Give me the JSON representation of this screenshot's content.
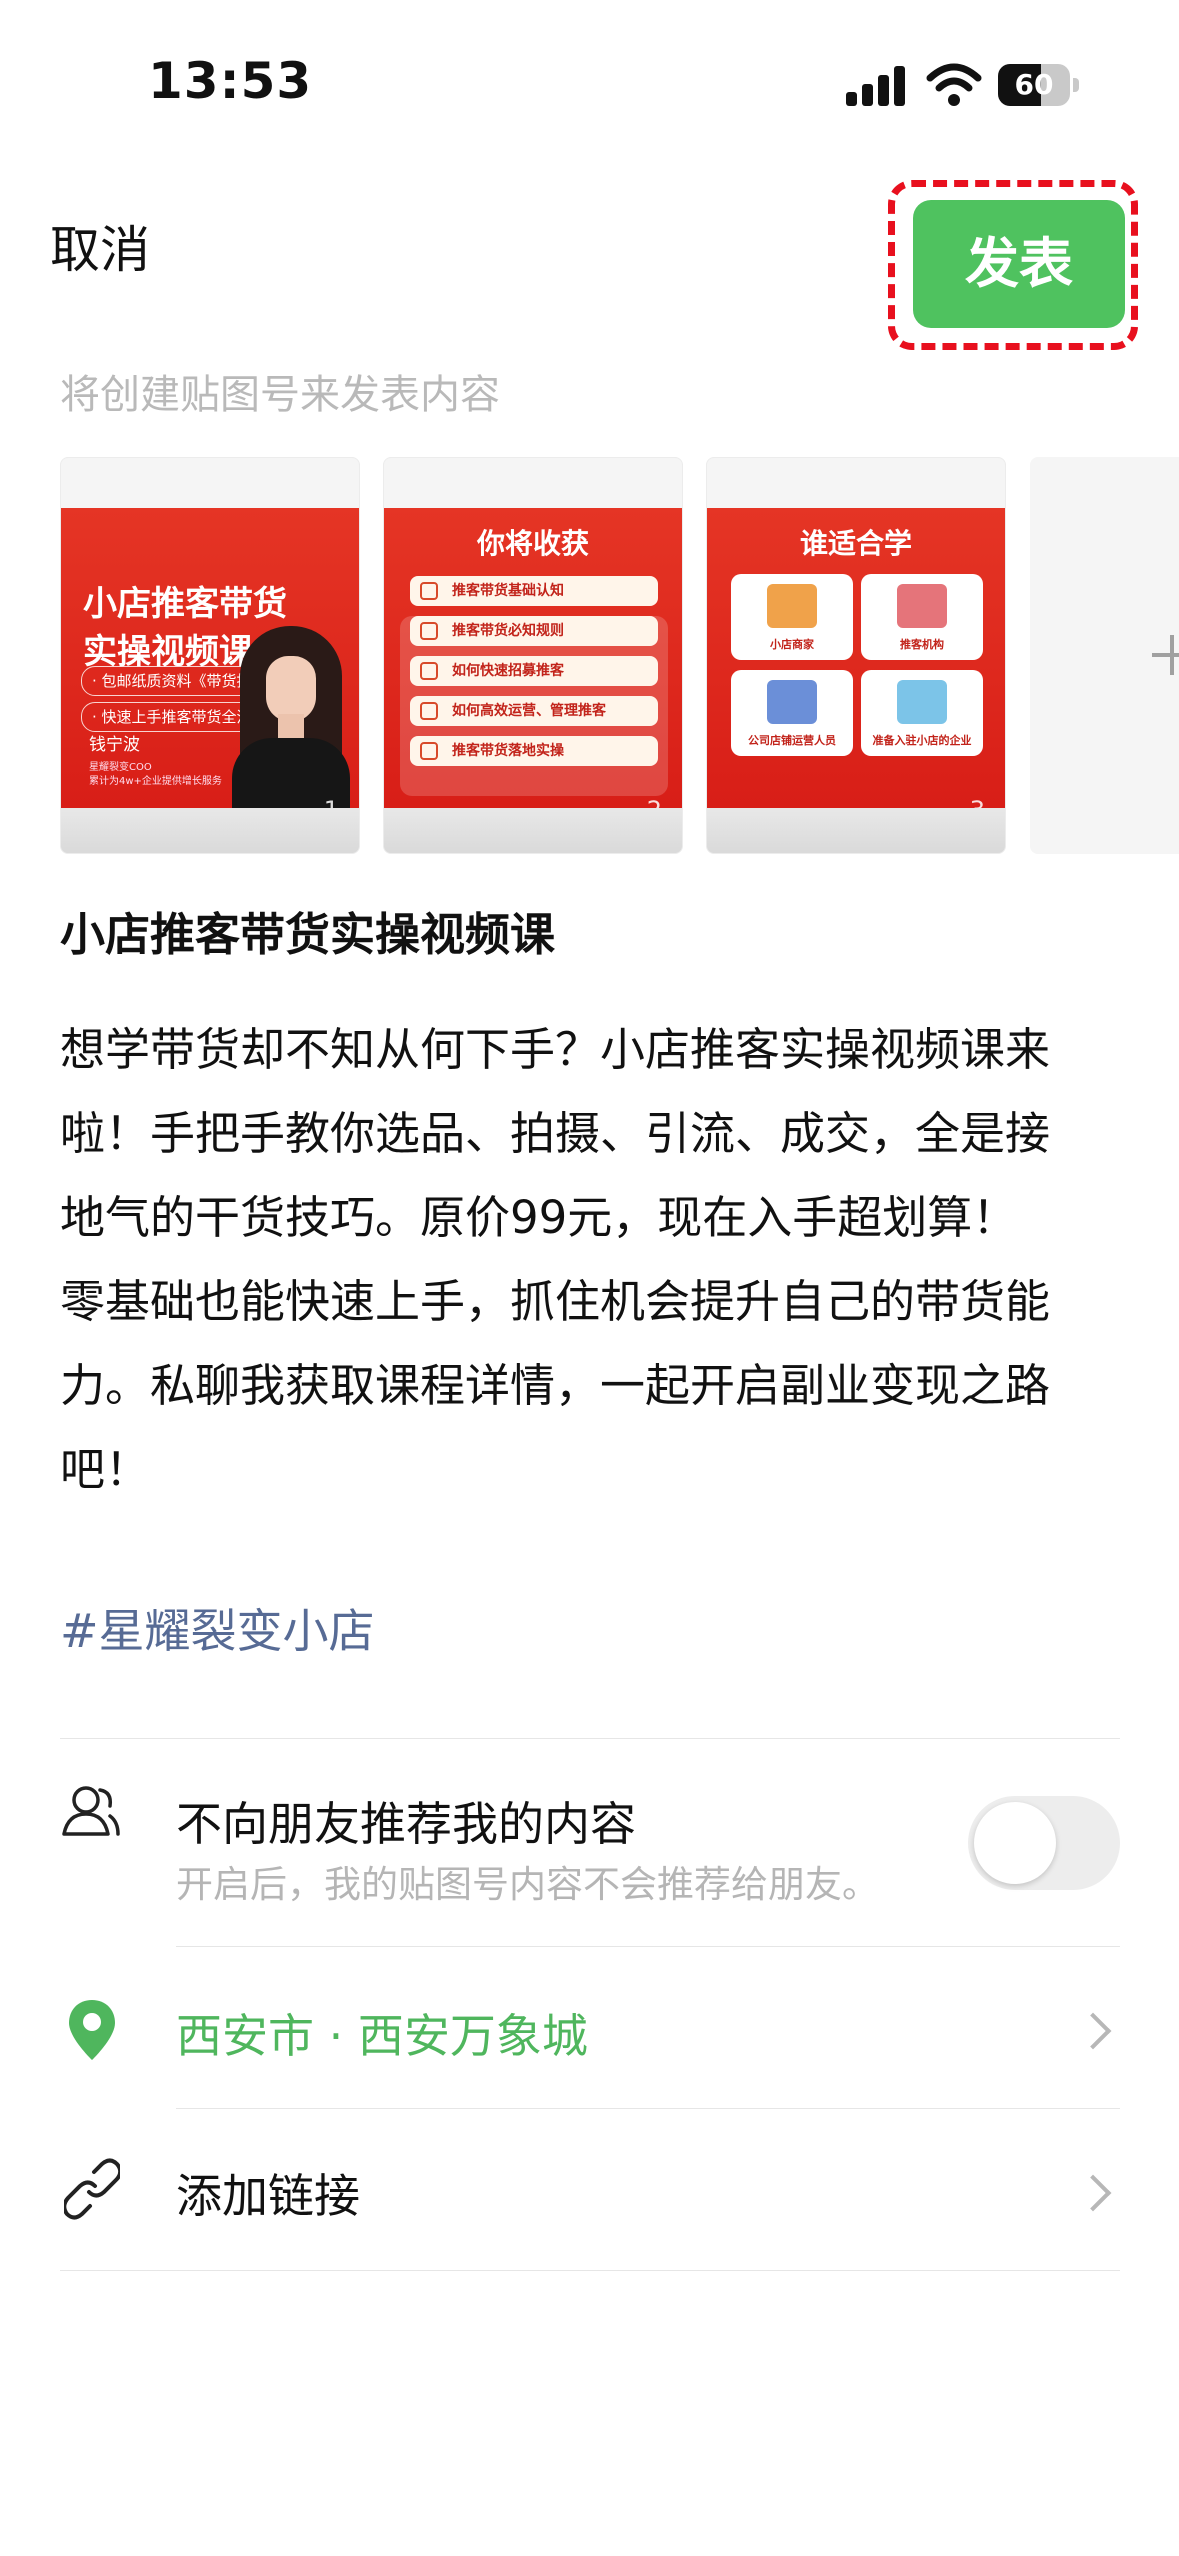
{
  "status_bar": {
    "time": "13:53",
    "battery": "60",
    "battery_level": 0.6
  },
  "header": {
    "cancel_label": "取消",
    "publish_label": "发表"
  },
  "hint": "将创建贴图号来发表内容",
  "thumbnails": [
    {
      "number": "1",
      "title_line1": "小店推客带货",
      "title_line2": "实操视频课",
      "tag1": "· 包邮纸质资料《带货指南》",
      "tag2": "· 快速上手推客带货全流程",
      "name": "钱宁波",
      "small1": "星耀裂变COO",
      "small2": "累计为4w+企业提供增长服务"
    },
    {
      "number": "2",
      "heading": "你将收获",
      "items": [
        "推客带货基础认知",
        "推客带货必知规则",
        "如何快速招募推客",
        "如何高效运营、管理推客",
        "推客带货落地实操"
      ]
    },
    {
      "number": "3",
      "heading": "谁适合学",
      "items": [
        "小店商家",
        "推客机构",
        "公司店铺运营人员",
        "准备入驻小店的企业"
      ]
    }
  ],
  "post": {
    "title": "小店推客带货实操视频课",
    "body_lines": [
      "想学带货却不知从何下手？小店推客实操视频课来",
      "啦！手把手教你选品、拍摄、引流、成交，全是接",
      "地气的干货技巧。原价99元，现在入手超划算！",
      "零基础也能快速上手，抓住机会提升自己的带货能",
      "力。私聊我获取课程详情，一起开启副业变现之路",
      "吧！"
    ],
    "hashtag": "#星耀裂变小店"
  },
  "settings": {
    "friends": {
      "title": "不向朋友推荐我的内容",
      "subtitle": "开启后，我的贴图号内容不会推荐给朋友。",
      "enabled": false
    },
    "location": {
      "text": "西安市 · 西安万象城"
    },
    "link": {
      "text": "添加链接"
    }
  },
  "colors": {
    "accent_green": "#4fc25f",
    "hashtag_blue": "#576b95",
    "highlight_red": "#e8101e",
    "poster_red": "#e53525"
  },
  "icons": {
    "friends": "person-outline-icon",
    "location": "location-pin-icon",
    "link": "link-icon",
    "chevron": "chevron-right-icon",
    "add": "plus-icon"
  }
}
